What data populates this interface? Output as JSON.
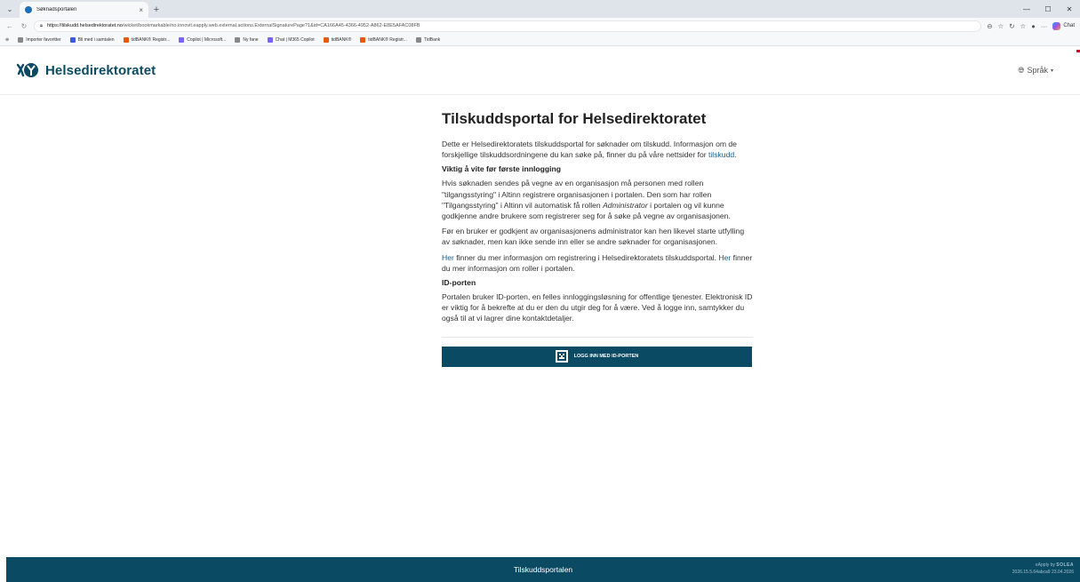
{
  "browser": {
    "tab_title": "Søknadsportalen",
    "tab_close": "×",
    "new_tab": "+",
    "url_host": "https://tilskudd.helsedirektoratet.no",
    "url_path": "/wicket/bookmarkable/no.innovit.eapply.web.external.actions.ExternalSignaturePage?1&id=CA166A45-4366-4952-A862-E8E5AFAC08FB",
    "chat_label": "Chat",
    "favorites": [
      {
        "label": "Importer favoritter",
        "color": "#888888"
      },
      {
        "label": "Bli med i samtalen",
        "color": "#3b5bdb"
      },
      {
        "label": "tidBANK® Registr...",
        "color": "#e8590c"
      },
      {
        "label": "Copilot | Microsoft...",
        "color": "#7b61ff"
      },
      {
        "label": "Ny fane",
        "color": "#888888"
      },
      {
        "label": "Chat | M365 Copilot",
        "color": "#7b61ff"
      },
      {
        "label": "tidBANK®",
        "color": "#e8590c"
      },
      {
        "label": "tidBANK® Registr...",
        "color": "#e8590c"
      },
      {
        "label": "TidBank",
        "color": "#888888"
      }
    ]
  },
  "header": {
    "logo_text": "Helsedirektoratet",
    "language_label": "Språk"
  },
  "main": {
    "title": "Tilskuddsportal for Helsedirektoratet",
    "intro_text": "Dette er Helsedirektoratets tilskuddsportal for søknader om tilskudd. Informasjon om de forskjellige tilskuddsordningene du kan søke på, finner du på våre nettsider for ",
    "intro_link": "tilskudd",
    "intro_end": ".",
    "section1_heading": "Viktig å vite før første innlogging",
    "para1_a": "Hvis søknaden sendes på vegne av en organisasjon må personen med rollen \"tilgangsstyring\" i Altinn registrere organisasjonen i portalen. Den som har rollen \"Tilgangsstyring\" i Altinn vil automatisk få rollen ",
    "para1_em": "Administrator",
    "para1_b": " i portalen og vil kunne godkjenne andre brukere som registrerer seg for å søke på vegne av organisasjonen.",
    "para2": "Før en bruker er godkjent av organisasjonens administrator kan hen likevel starte utfylling av søknader, men kan ikke sende inn eller se andre søknader for organisasjonen.",
    "para3_link1": "Her",
    "para3_a": " finner du mer informasjon om registrering i Helsedirektoratets tilskuddsportal. ",
    "para3_link2": "Her",
    "para3_b": " finner du mer informasjon om roller i portalen.",
    "section2_heading": "ID-porten",
    "para4": "Portalen bruker ID-porten, en felles innloggingsløsning for offentlige tjenester. Elektronisk ID er viktig for å bekrefte at du er den du utgir deg for å være. Ved å logge inn, samtykker du også til at vi lagrer dine kontaktdetaljer.",
    "login_button": "LOGG INN MED ID-PORTEN"
  },
  "footer": {
    "title": "Tilskuddsportalen",
    "powered_by": "eApply by",
    "brand": "SOLEA",
    "version": "2026.15.5.64abca9 23.04.2026"
  },
  "colors": {
    "primary": "#0b4a63",
    "link": "#1a5d8a"
  }
}
